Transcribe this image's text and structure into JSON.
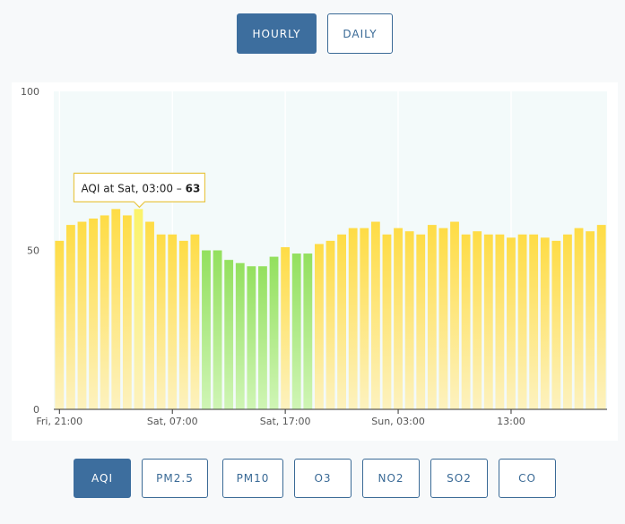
{
  "toggle": {
    "hourly_label": "HOURLY",
    "daily_label": "DAILY",
    "active": "hourly"
  },
  "pollutants": [
    {
      "label": "AQI",
      "active": true
    },
    {
      "label": "PM2.5",
      "active": false
    },
    {
      "label": "PM10",
      "active": false
    },
    {
      "label": "O3",
      "active": false
    },
    {
      "label": "NO2",
      "active": false
    },
    {
      "label": "SO2",
      "active": false
    },
    {
      "label": "CO",
      "active": false
    }
  ],
  "colors": {
    "moderate_top": "#fedc45",
    "moderate_bottom": "#fdf2bf",
    "good_top": "#93e05e",
    "good_bottom": "#cff5b5",
    "highlight": "#fbf36a",
    "plot_bg": "#f3fafa",
    "accent": "#3d6e9e"
  },
  "chart_data": {
    "type": "bar",
    "ylim": [
      0,
      100
    ],
    "yticks": [
      0,
      50,
      100
    ],
    "x_tick_labels": [
      {
        "index": 0,
        "label": "Fri, 21:00"
      },
      {
        "index": 10,
        "label": "Sat, 07:00"
      },
      {
        "index": 20,
        "label": "Sat, 17:00"
      },
      {
        "index": 30,
        "label": "Sun, 03:00"
      },
      {
        "index": 40,
        "label": "13:00"
      }
    ],
    "values": [
      53,
      58,
      59,
      60,
      61,
      63,
      61,
      63,
      59,
      55,
      55,
      53,
      55,
      50,
      50,
      47,
      46,
      45,
      45,
      48,
      51,
      49,
      49,
      52,
      53,
      55,
      57,
      57,
      59,
      55,
      57,
      56,
      55,
      58,
      57,
      59,
      55,
      56,
      55,
      55,
      54,
      55,
      55,
      54,
      53,
      55,
      57,
      56,
      58
    ],
    "good_threshold": 50,
    "highlight_index": 7,
    "tooltip": {
      "prefix": "AQI at Sat, 03:00 – ",
      "value": "63"
    }
  }
}
